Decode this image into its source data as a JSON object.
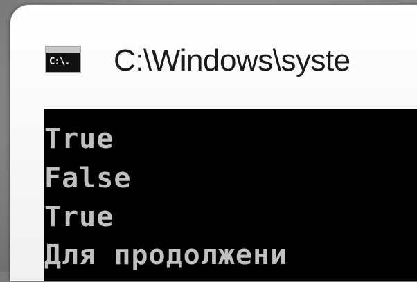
{
  "window": {
    "title": "C:\\Windows\\syste",
    "icon_label": "C:\\."
  },
  "console": {
    "lines": [
      "True",
      "False",
      "True",
      "Для продолжени"
    ]
  },
  "colors": {
    "console_background": "#000000",
    "console_text": "#c0c0c0",
    "title_text": "#1a1a1a"
  }
}
